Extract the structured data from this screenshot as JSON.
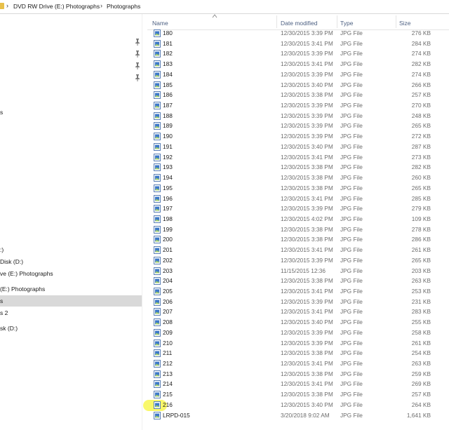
{
  "breadcrumb": {
    "items": [
      "DVD RW Drive (E:) Photographs",
      "Photographs"
    ],
    "separator": "›"
  },
  "nav": {
    "items": [
      {
        "label": "s",
        "selected": false
      },
      {
        "label": ":)",
        "selected": false
      },
      {
        "label": "Disk (D:)",
        "selected": false
      },
      {
        "label": "ve (E:) Photographs",
        "selected": false
      },
      {
        "label": "(E:) Photographs",
        "selected": false
      },
      {
        "label": "s",
        "selected": true
      },
      {
        "label": "s 2",
        "selected": false
      },
      {
        "label": "sk (D:)",
        "selected": false
      }
    ]
  },
  "columns": {
    "name": "Name",
    "date": "Date modified",
    "type": "Type",
    "size": "Size"
  },
  "files": [
    {
      "name": "180",
      "date": "12/30/2015 3:39 PM",
      "type": "JPG File",
      "size": "276 KB"
    },
    {
      "name": "181",
      "date": "12/30/2015 3:41 PM",
      "type": "JPG File",
      "size": "284 KB"
    },
    {
      "name": "182",
      "date": "12/30/2015 3:39 PM",
      "type": "JPG File",
      "size": "274 KB"
    },
    {
      "name": "183",
      "date": "12/30/2015 3:41 PM",
      "type": "JPG File",
      "size": "282 KB"
    },
    {
      "name": "184",
      "date": "12/30/2015 3:39 PM",
      "type": "JPG File",
      "size": "274 KB"
    },
    {
      "name": "185",
      "date": "12/30/2015 3:40 PM",
      "type": "JPG File",
      "size": "266 KB"
    },
    {
      "name": "186",
      "date": "12/30/2015 3:38 PM",
      "type": "JPG File",
      "size": "257 KB"
    },
    {
      "name": "187",
      "date": "12/30/2015 3:39 PM",
      "type": "JPG File",
      "size": "270 KB"
    },
    {
      "name": "188",
      "date": "12/30/2015 3:39 PM",
      "type": "JPG File",
      "size": "248 KB"
    },
    {
      "name": "189",
      "date": "12/30/2015 3:39 PM",
      "type": "JPG File",
      "size": "265 KB"
    },
    {
      "name": "190",
      "date": "12/30/2015 3:39 PM",
      "type": "JPG File",
      "size": "272 KB"
    },
    {
      "name": "191",
      "date": "12/30/2015 3:40 PM",
      "type": "JPG File",
      "size": "287 KB"
    },
    {
      "name": "192",
      "date": "12/30/2015 3:41 PM",
      "type": "JPG File",
      "size": "273 KB"
    },
    {
      "name": "193",
      "date": "12/30/2015 3:38 PM",
      "type": "JPG File",
      "size": "282 KB"
    },
    {
      "name": "194",
      "date": "12/30/2015 3:38 PM",
      "type": "JPG File",
      "size": "260 KB"
    },
    {
      "name": "195",
      "date": "12/30/2015 3:38 PM",
      "type": "JPG File",
      "size": "265 KB"
    },
    {
      "name": "196",
      "date": "12/30/2015 3:41 PM",
      "type": "JPG File",
      "size": "285 KB"
    },
    {
      "name": "197",
      "date": "12/30/2015 3:39 PM",
      "type": "JPG File",
      "size": "279 KB"
    },
    {
      "name": "198",
      "date": "12/30/2015 4:02 PM",
      "type": "JPG File",
      "size": "109 KB"
    },
    {
      "name": "199",
      "date": "12/30/2015 3:38 PM",
      "type": "JPG File",
      "size": "278 KB"
    },
    {
      "name": "200",
      "date": "12/30/2015 3:38 PM",
      "type": "JPG File",
      "size": "286 KB"
    },
    {
      "name": "201",
      "date": "12/30/2015 3:41 PM",
      "type": "JPG File",
      "size": "261 KB"
    },
    {
      "name": "202",
      "date": "12/30/2015 3:39 PM",
      "type": "JPG File",
      "size": "265 KB"
    },
    {
      "name": "203",
      "date": "11/15/2015 12:36",
      "type": "JPG File",
      "size": "203 KB"
    },
    {
      "name": "204",
      "date": "12/30/2015 3:38 PM",
      "type": "JPG File",
      "size": "263 KB"
    },
    {
      "name": "205",
      "date": "12/30/2015 3:41 PM",
      "type": "JPG File",
      "size": "253 KB"
    },
    {
      "name": "206",
      "date": "12/30/2015 3:39 PM",
      "type": "JPG File",
      "size": "231 KB"
    },
    {
      "name": "207",
      "date": "12/30/2015 3:41 PM",
      "type": "JPG File",
      "size": "283 KB"
    },
    {
      "name": "208",
      "date": "12/30/2015 3:40 PM",
      "type": "JPG File",
      "size": "255 KB"
    },
    {
      "name": "209",
      "date": "12/30/2015 3:39 PM",
      "type": "JPG File",
      "size": "258 KB"
    },
    {
      "name": "210",
      "date": "12/30/2015 3:39 PM",
      "type": "JPG File",
      "size": "261 KB"
    },
    {
      "name": "211",
      "date": "12/30/2015 3:38 PM",
      "type": "JPG File",
      "size": "254 KB"
    },
    {
      "name": "212",
      "date": "12/30/2015 3:41 PM",
      "type": "JPG File",
      "size": "263 KB"
    },
    {
      "name": "213",
      "date": "12/30/2015 3:38 PM",
      "type": "JPG File",
      "size": "259 KB"
    },
    {
      "name": "214",
      "date": "12/30/2015 3:41 PM",
      "type": "JPG File",
      "size": "269 KB"
    },
    {
      "name": "215",
      "date": "12/30/2015 3:38 PM",
      "type": "JPG File",
      "size": "257 KB"
    },
    {
      "name": "216",
      "date": "12/30/2015 3:40 PM",
      "type": "JPG File",
      "size": "264 KB",
      "highlighted": true
    },
    {
      "name": "LRPD-015",
      "date": "3/20/2018 9:02 AM",
      "type": "JPG File",
      "size": "1,641 KB"
    }
  ],
  "colors": {
    "header_text": "#4d6082",
    "selected_nav": "#d9d9d9",
    "highlight": "#f7f53a",
    "folder": "#e8c04a"
  }
}
